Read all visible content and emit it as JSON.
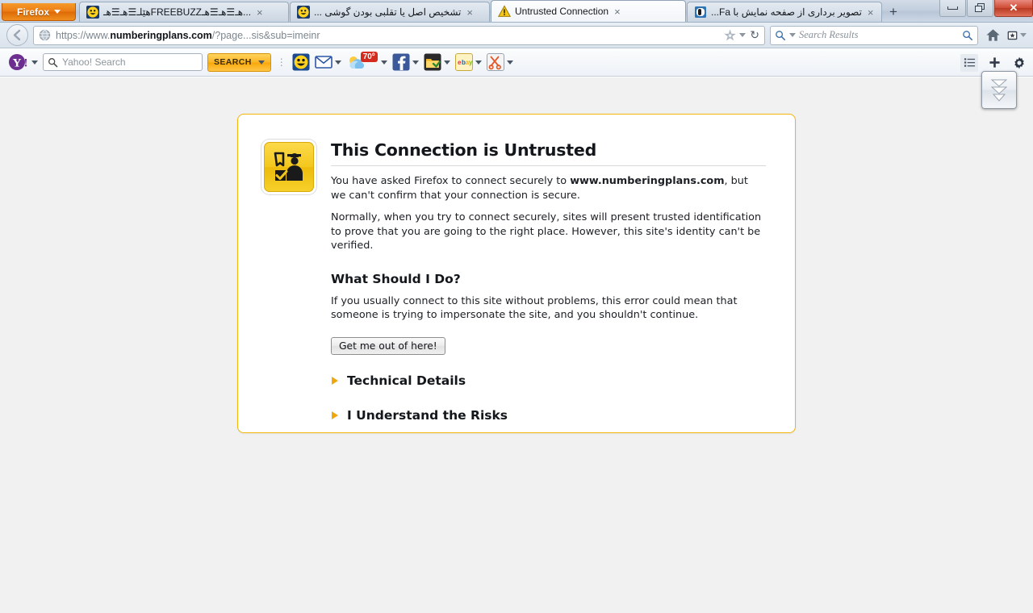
{
  "window": {
    "firefox_button_label": "Firefox",
    "controls": {
      "minimize": "minimize-button",
      "restore": "restore-button",
      "close_label": "✕"
    }
  },
  "tabs": [
    {
      "label": "هێلـ☰هـ☰هـFREEBUZZهـ☰هـ☰هـ...",
      "favicon": "smiley-icon",
      "active": false,
      "close_label": "×"
    },
    {
      "label": "تشخیص اصل یا تقلبی بودن گوشی ...",
      "favicon": "smiley-icon",
      "active": false,
      "close_label": "×"
    },
    {
      "label": "Untrusted Connection",
      "favicon": "warning-triangle-icon",
      "active": true,
      "close_label": "×"
    },
    {
      "label": "تصویر برداری از صفحه نمایش با Fa...",
      "favicon": "generic-page-icon",
      "active": false,
      "close_label": "×"
    }
  ],
  "newtab": {
    "label": "+"
  },
  "navbar": {
    "back_label": "←",
    "url_scheme": "https://www.",
    "url_domain": "numberingplans.com",
    "url_path": "/?page...sis&sub=imeinr",
    "search_placeholder": "Search Results",
    "icons": {
      "site": "globe-icon",
      "bookmark": "star-icon",
      "bookmark_dropdown": "chevron-down-icon",
      "reload": "reload-icon",
      "search": "magnifier-icon",
      "home": "home-icon",
      "bookmarks_sidebar": "bookmarks-icon"
    }
  },
  "yahoo_toolbar": {
    "logo_text": "Y!",
    "search_placeholder": "Yahoo! Search",
    "search_button_label": "SEARCH",
    "weather_temp": "70º",
    "items": [
      {
        "name": "messenger-icon",
        "has_caret": false
      },
      {
        "name": "mail-icon",
        "has_caret": true
      },
      {
        "name": "weather-icon",
        "has_caret": true
      },
      {
        "name": "facebook-icon",
        "has_caret": true
      },
      {
        "name": "notepad-icon",
        "has_caret": true
      },
      {
        "name": "ebay-icon",
        "has_caret": true
      },
      {
        "name": "clip-icon",
        "has_caret": true
      }
    ],
    "right_buttons": [
      {
        "name": "list-view-icon"
      },
      {
        "name": "plus-icon"
      },
      {
        "name": "gear-icon"
      }
    ]
  },
  "download_button": {
    "name": "downloads-arrow-icon"
  },
  "error_page": {
    "icon": "untrusted-connection-icon",
    "title": "This Connection is Untrusted",
    "paragraph1_pre": "You have asked Firefox to connect securely to ",
    "paragraph1_host": "www.numberingplans.com",
    "paragraph1_post": ", but we can't confirm that your connection is secure.",
    "paragraph2": "Normally, when you try to connect securely, sites will present trusted identification to prove that you are going to the right place. However, this site's identity can't be verified.",
    "subheading": "What Should I Do?",
    "paragraph3": "If you usually connect to this site without problems, this error could mean that someone is trying to impersonate the site, and you shouldn't continue.",
    "button_label": "Get me out of here!",
    "expanders": [
      {
        "label": "Technical Details"
      },
      {
        "label": "I Understand the Risks"
      }
    ]
  },
  "colors": {
    "accent_orange": "#f0a60d",
    "box_border": "#f2b50c",
    "yahoo_purple": "#6d2f8f",
    "content_bg": "#f1f1f1"
  }
}
